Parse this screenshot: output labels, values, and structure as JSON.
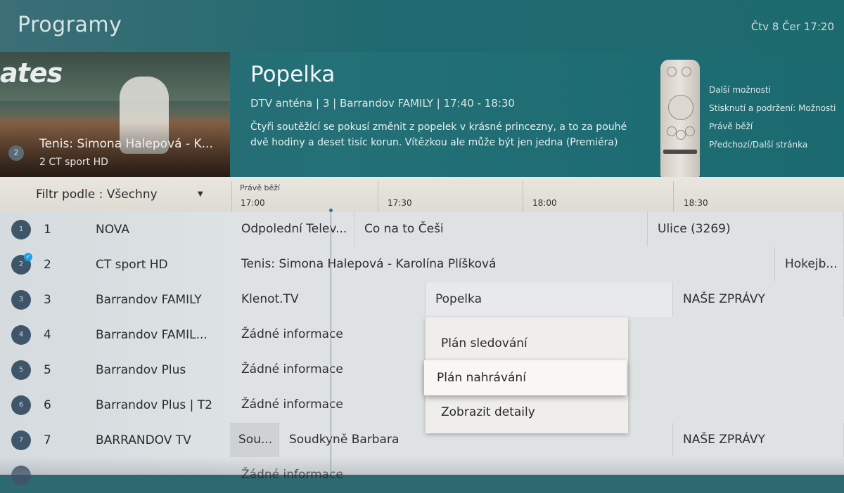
{
  "header": {
    "title": "Programy",
    "datetime": "Čtv 8 Čer 17:20"
  },
  "preview": {
    "logo_text": "ates",
    "channel_badge": "2",
    "program_title": "Tenis: Simona Halepová - K...",
    "channel_line": "2   CT sport HD"
  },
  "detail": {
    "title": "Popelka",
    "meta": "DTV anténa  |  3  |  Barrandov FAMILY  |  17:40 - 18:30",
    "description": "Čtyři soutěžící se pokusí změnit z popelek v krásné princezny, a to za pouhé dvě hodiny a deset tisíc korun. Vítězkou ale může být jen jedna (Premiéra)"
  },
  "remote_hints": {
    "more": "Další možnosti",
    "press_hold": "Stisknutí a podržení: Možnosti",
    "now_playing": "Právě běží",
    "page": "Předchozí/Další stránka"
  },
  "timeline": {
    "filter_label": "Filtr podle : Všechny",
    "now_label": "Právě běží",
    "times": [
      "17:00",
      "17:30",
      "18:00",
      "18:30"
    ]
  },
  "channels": [
    {
      "badge": "1",
      "num": "1",
      "name": "NOVA"
    },
    {
      "badge": "2",
      "num": "2",
      "name": "CT sport HD"
    },
    {
      "badge": "3",
      "num": "3",
      "name": "Barrandov FAMILY"
    },
    {
      "badge": "4",
      "num": "4",
      "name": "Barrandov FAMIL..."
    },
    {
      "badge": "5",
      "num": "5",
      "name": "Barrandov Plus"
    },
    {
      "badge": "6",
      "num": "6",
      "name": "Barrandov Plus | T2"
    },
    {
      "badge": "7",
      "num": "7",
      "name": "BARRANDOV TV"
    }
  ],
  "programs": {
    "r1": [
      "Odpolední Telev...",
      "Co na to Češi",
      "Ulice (3269)"
    ],
    "r2": [
      "Tenis: Simona Halepová - Karolína Plíšková",
      "Hokejb..."
    ],
    "r3": [
      "Klenot.TV",
      "Popelka",
      "NAŠE ZPRÁVY"
    ],
    "r4": [
      "Žádné informace"
    ],
    "r5": [
      "Žádné informace"
    ],
    "r6": [
      "Žádné informace"
    ],
    "r7": [
      "Sou...",
      "Soudkyně Barbara",
      "NAŠE ZPRÁVY"
    ],
    "r8": [
      "Žádné informace"
    ]
  },
  "context_menu": {
    "items": [
      "Plán sledování",
      "Plán nahrávání",
      "Zobrazit detaily"
    ],
    "focused_index": 1
  },
  "colors": {
    "header_teal": "#1f6a70",
    "badge": "#3f566a",
    "check": "#1ea0e6"
  }
}
